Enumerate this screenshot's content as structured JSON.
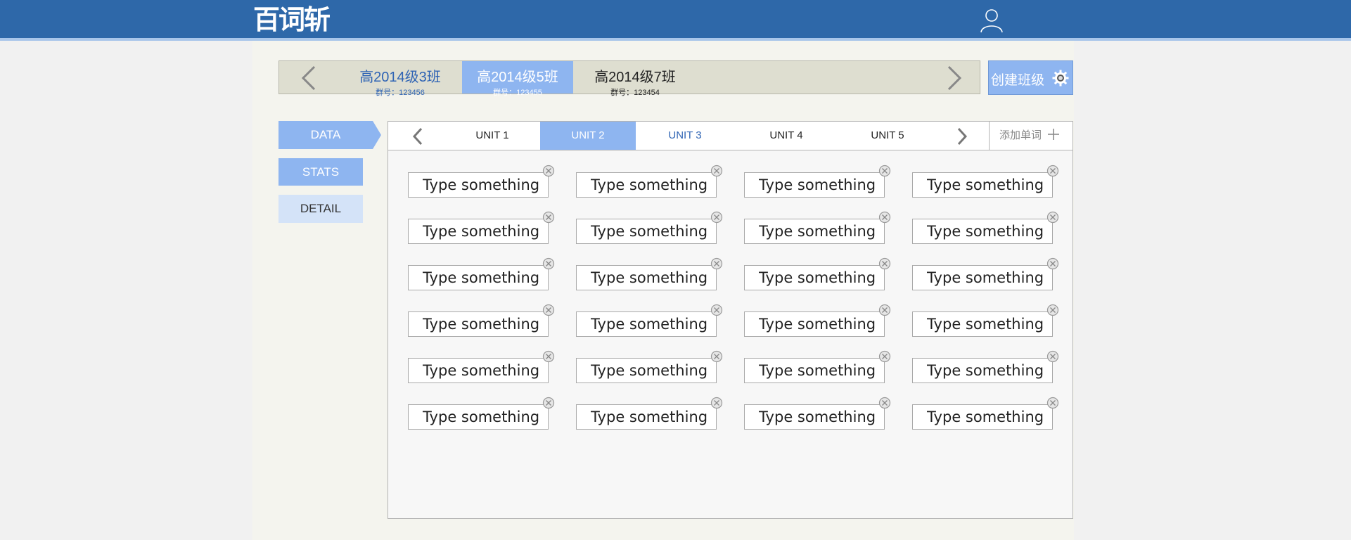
{
  "header": {
    "logo_text": "百词斩",
    "user_icon": "user-icon"
  },
  "classes": {
    "items": [
      {
        "name": "高2014级3班",
        "group": "群号：123456"
      },
      {
        "name": "高2014级5班",
        "group": "群号：123455",
        "selected": true
      },
      {
        "name": "高2014级7班",
        "group": "群号：123454"
      }
    ],
    "create_label": "创建班级",
    "create_icon": "gear-icon"
  },
  "nav": {
    "data": "DATA",
    "stats": "STATS",
    "detail": "DETAIL"
  },
  "units": {
    "tabs": [
      "UNIT 1",
      "UNIT 2",
      "UNIT 3",
      "UNIT 4",
      "UNIT 5"
    ],
    "active": "UNIT 2",
    "add_word_label": "添加单词"
  },
  "words": {
    "placeholder": "Type something",
    "rows": 6,
    "cols": 4
  },
  "colors": {
    "header": "#2e68a9",
    "accent": "#8eb5f0",
    "link": "#2f64b4"
  }
}
